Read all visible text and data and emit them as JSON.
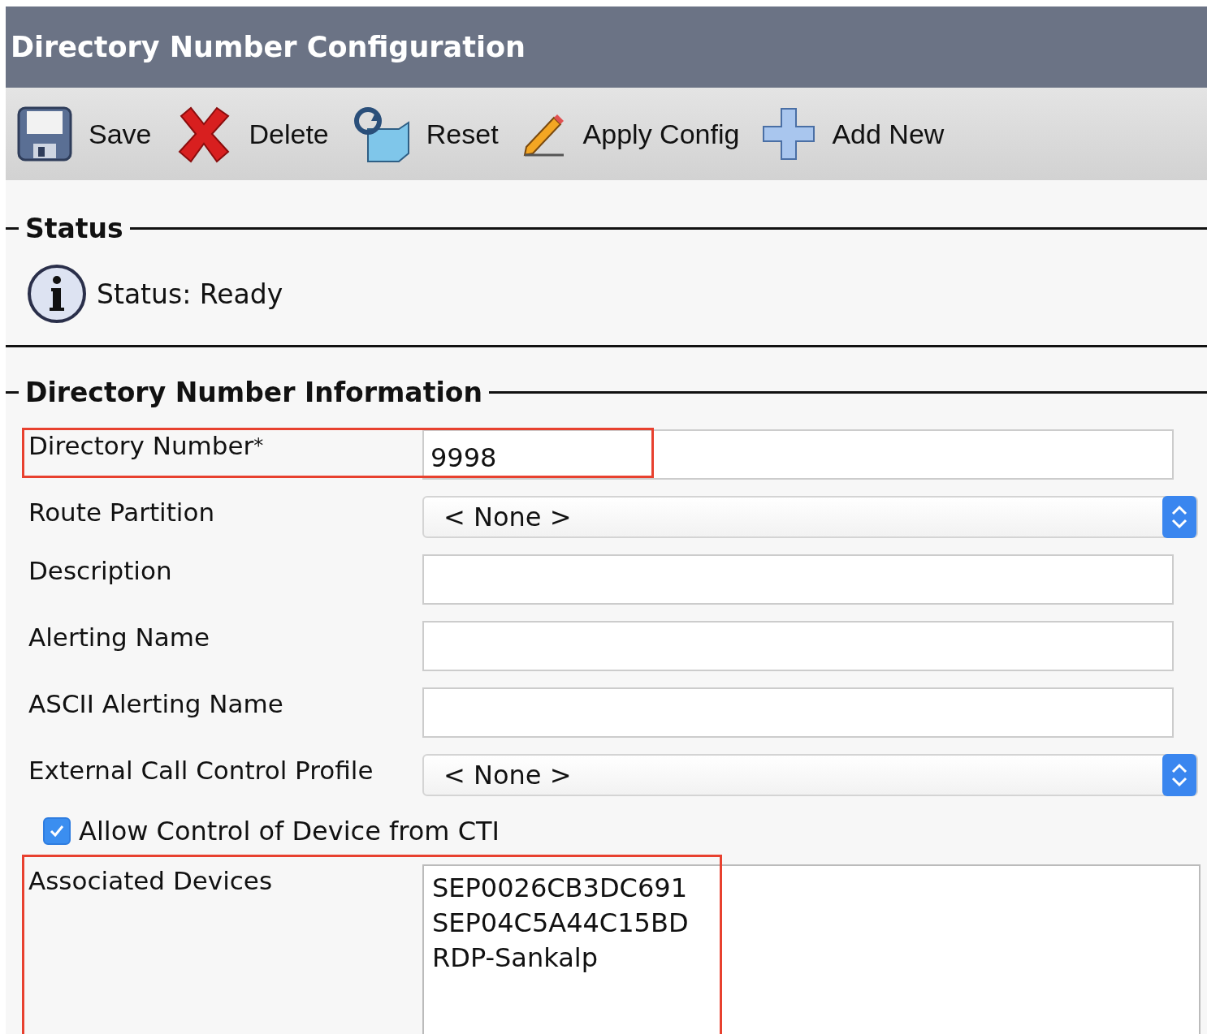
{
  "window": {
    "title": "Directory Number Configuration"
  },
  "toolbar": [
    {
      "kind": "save",
      "label": "Save"
    },
    {
      "kind": "delete",
      "label": "Delete"
    },
    {
      "kind": "reset",
      "label": "Reset"
    },
    {
      "kind": "apply",
      "label": "Apply Config"
    },
    {
      "kind": "add",
      "label": "Add New"
    }
  ],
  "status": {
    "heading": "Status",
    "message": "Status: Ready"
  },
  "info": {
    "heading": "Directory Number Information",
    "fields": [
      {
        "kind": "text",
        "label": "Directory Number",
        "required_mark": "*",
        "value": "9998",
        "highlighted": true
      },
      {
        "kind": "select",
        "label": "Route Partition",
        "value": "< None >",
        "highlighted": false
      },
      {
        "kind": "text",
        "label": "Description",
        "highlighted": false
      },
      {
        "kind": "text",
        "label": "Alerting Name",
        "highlighted": false
      },
      {
        "kind": "text",
        "label": "ASCII Alerting Name",
        "highlighted": false
      },
      {
        "kind": "select",
        "label": "External Call Control Profile",
        "value": "< None >",
        "highlighted": false
      },
      {
        "kind": "checkbox",
        "label": "Allow Control of Device from CTI",
        "checked": true,
        "highlighted": false
      },
      {
        "kind": "list",
        "label": "Associated Devices",
        "items": [
          "SEP0026CB3DC691",
          "SEP04C5A44C15BD",
          "RDP-Sankalp"
        ],
        "highlighted": true
      }
    ]
  }
}
